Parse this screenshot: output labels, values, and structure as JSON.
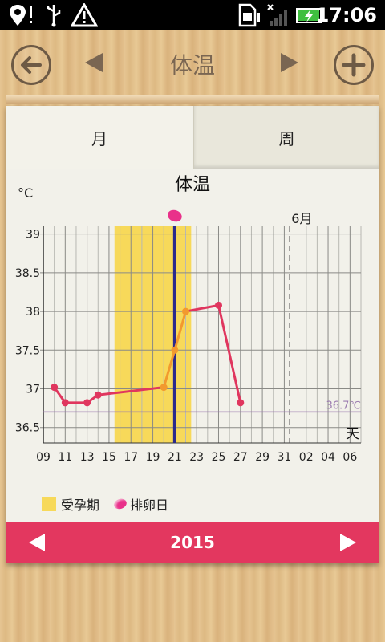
{
  "status_bar": {
    "time": "17:06",
    "icons": [
      "location-alert-icon",
      "usb-icon",
      "warning-icon",
      "sim-card-icon",
      "signal-icon",
      "battery-charging-icon"
    ]
  },
  "header": {
    "title": "体温",
    "back_icon": "arrow-left-icon",
    "prev_icon": "triangle-left-icon",
    "next_icon": "triangle-right-icon",
    "add_icon": "plus-icon"
  },
  "tabs": [
    {
      "label": "月",
      "selected": true
    },
    {
      "label": "周",
      "selected": false
    }
  ],
  "legend": {
    "fertile_label": "受孕期",
    "ovulation_label": "排卵日"
  },
  "footer": {
    "year": "2015",
    "prev_icon": "triangle-left-icon",
    "next_icon": "triangle-right-icon"
  },
  "colors": {
    "accent": "#e3375f",
    "fertile": "#f7d95a",
    "line": "#e0365e",
    "ovulation_line": "#2b2a8c",
    "threshold": "#9b7bb0",
    "ovulation_marker": "#e9318a"
  },
  "chart_data": {
    "type": "line",
    "title": "体温",
    "ylabel": "°C",
    "xlabel": "天",
    "ylim": [
      36.3,
      39.1
    ],
    "y_ticks": [
      "39",
      "38.5",
      "38",
      "37.5",
      "37",
      "36.5"
    ],
    "x_tick_labels": [
      "09",
      "11",
      "13",
      "15",
      "17",
      "19",
      "21",
      "23",
      "25",
      "27",
      "29",
      "31",
      "02",
      "04",
      "06"
    ],
    "month_marker": {
      "label": "6月",
      "day": 32
    },
    "fertile_window": [
      16,
      22
    ],
    "ovulation_day": 21,
    "threshold": {
      "label": "36.7℃",
      "value": 36.7
    },
    "series": [
      {
        "x": [
          10,
          11,
          13,
          14,
          20,
          21,
          22,
          25,
          27
        ],
        "y": [
          37.02,
          36.82,
          36.82,
          36.92,
          37.02,
          37.5,
          38.0,
          38.08,
          36.82
        ],
        "highlighted_days_in_window": [
          16,
          22
        ]
      }
    ]
  }
}
